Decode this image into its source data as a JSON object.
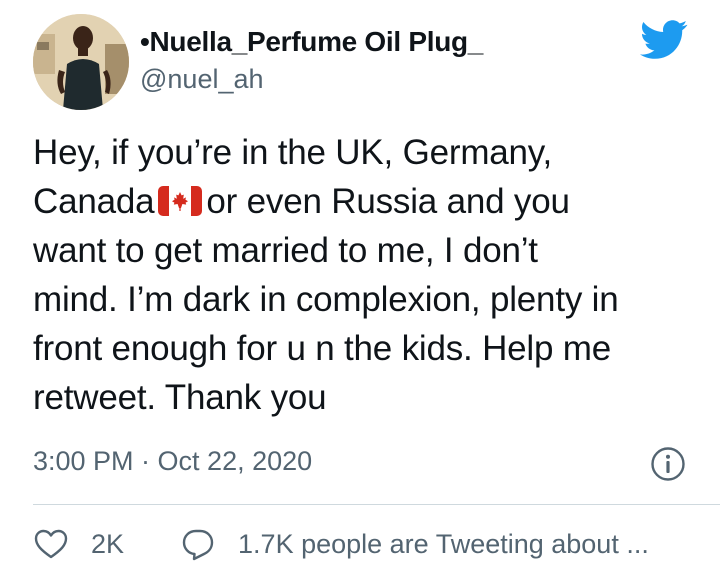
{
  "user": {
    "display_name": "•Nuella_Perfume Oil Plug_",
    "handle": "@nuel_ah"
  },
  "tweet": {
    "lines": [
      "Hey, if you’re in the UK, Germany,",
      "Canada",
      "or even Russia and you",
      "want to get married to me, I don’t",
      "mind. I’m dark in complexion, plenty in",
      "front enough for u n the kids. Help me",
      "retweet. Thank you"
    ],
    "timestamp": "3:00 PM · Oct 22, 2020"
  },
  "actions": {
    "likes": "2K",
    "conversation": "1.7K people are Tweeting about ..."
  },
  "icons": {
    "brand": "twitter-bird-icon",
    "info": "info-icon",
    "like": "heart-icon",
    "reply": "speech-bubble-icon",
    "flag": "canada-flag-emoji"
  },
  "colors": {
    "twitter_blue": "#1d9bf0",
    "text": "#0f1419",
    "secondary_text": "#536471",
    "divider": "#cfd9de",
    "flag_red": "#d52b1e"
  }
}
